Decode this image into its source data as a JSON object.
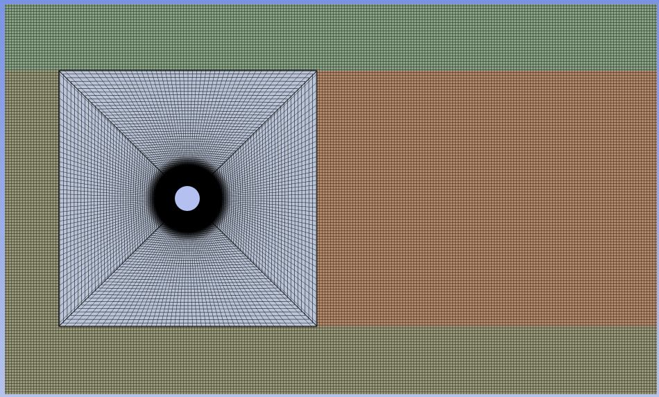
{
  "viewer": {
    "background_top": "#7b93e4",
    "background_bottom": "#b5c2ea"
  },
  "mesh": {
    "regions": [
      {
        "name": "upper-far-field",
        "fill": "#8aa585"
      },
      {
        "name": "lower-far-field",
        "fill": "#9a9a78"
      },
      {
        "name": "wake-region",
        "fill": "#b48a6b"
      },
      {
        "name": "cylinder-block",
        "fill": "#b9c4d8"
      }
    ],
    "line_color": "#1b1b1b",
    "cylinder_fill": "#b3c0f0",
    "dense_core_fill": "#000000"
  }
}
